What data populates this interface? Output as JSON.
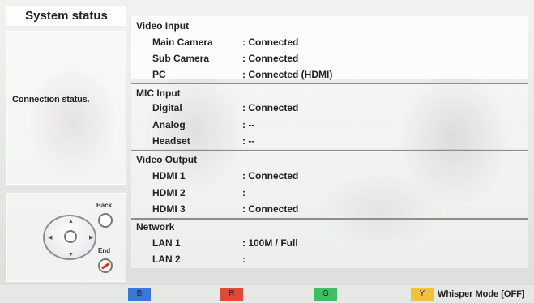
{
  "left": {
    "title": "System status",
    "description": "Connection status.",
    "nav": {
      "back_label": "Back",
      "end_label": "End"
    }
  },
  "sections": [
    {
      "header": "Video Input",
      "rows": [
        {
          "label": "Main Camera",
          "value": ": Connected"
        },
        {
          "label": "Sub Camera",
          "value": ": Connected"
        },
        {
          "label": "PC",
          "value": ": Connected (HDMI)"
        }
      ]
    },
    {
      "header": "MIC Input",
      "rows": [
        {
          "label": "Digital",
          "value": ": Connected"
        },
        {
          "label": "Analog",
          "value": ": --"
        },
        {
          "label": "Headset",
          "value": ": --"
        }
      ]
    },
    {
      "header": "Video Output",
      "rows": [
        {
          "label": "HDMI 1",
          "value": ": Connected"
        },
        {
          "label": "HDMI 2",
          "value": ":"
        },
        {
          "label": "HDMI 3",
          "value": ": Connected"
        }
      ]
    },
    {
      "header": "Network",
      "rows": [
        {
          "label": "LAN 1",
          "value": ": 100M / Full"
        },
        {
          "label": "LAN 2",
          "value": ":"
        }
      ]
    }
  ],
  "bottom": {
    "buttons": [
      {
        "key": "B",
        "color": "#3a78d8"
      },
      {
        "key": "R",
        "color": "#e0483a"
      },
      {
        "key": "G",
        "color": "#3fbf64"
      },
      {
        "key": "Y",
        "color": "#f0c238"
      }
    ],
    "whisper_label": "Whisper Mode [OFF]"
  }
}
